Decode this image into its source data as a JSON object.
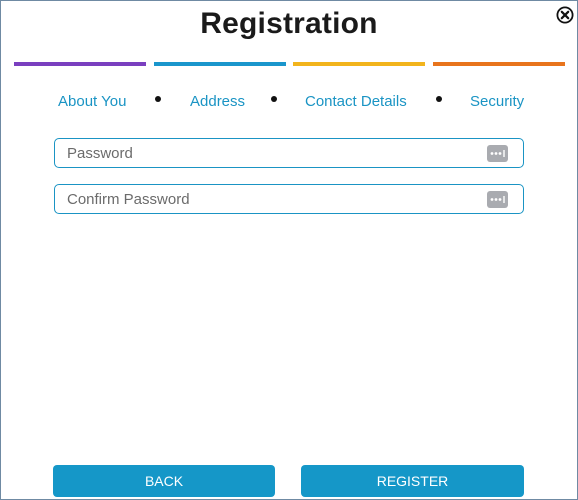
{
  "dialog": {
    "title": "Registration",
    "close_icon": "close-circle-icon"
  },
  "steps": [
    {
      "label": "About You",
      "color": "#7a3fbf"
    },
    {
      "label": "Address",
      "color": "#1a96cc"
    },
    {
      "label": "Contact Details",
      "color": "#f2b41c"
    },
    {
      "label": "Security",
      "color": "#e8741c"
    }
  ],
  "form": {
    "password": {
      "placeholder": "Password",
      "value": "",
      "icon": "password-dots-icon"
    },
    "confirm_password": {
      "placeholder": "Confirm Password",
      "value": "",
      "icon": "password-dots-icon"
    }
  },
  "buttons": {
    "back_label": "BACK",
    "register_label": "REGISTER"
  },
  "colors": {
    "accent": "#1a94c4",
    "button_bg": "#1597c8",
    "button_text": "#ffffff",
    "title_text": "#1a1a1a"
  }
}
